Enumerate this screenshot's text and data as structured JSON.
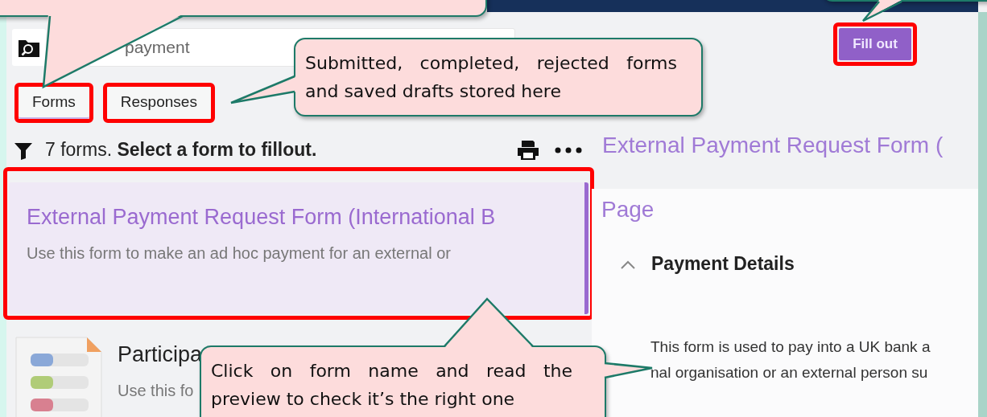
{
  "search": {
    "value": "payment"
  },
  "tabs": [
    {
      "label": "Forms",
      "selected": true
    },
    {
      "label": "Responses",
      "selected": false
    }
  ],
  "list_header": "7 forms. **Select a form to fillout.**",
  "forms": [
    {
      "title": "External Payment Request Form (International B",
      "description": "Use this form to make an ad hoc payment for an external or",
      "selected": true
    },
    {
      "title": "Participa",
      "description": "Use this fo",
      "selected": false
    }
  ],
  "fill_out_button": {
    "label": "Fill out"
  },
  "preview": {
    "title": "External Payment Request Form (",
    "page_label": "Page",
    "section": {
      "title": "Payment Details",
      "expanded": true
    },
    "body": [
      "This form is used to pay into a UK bank a",
      "nal organisation or an external person su"
    ]
  },
  "annotations": [
    {
      "text": "Submitted, completed, rejected forms and saved drafts stored here"
    },
    {
      "text": "Click on form name and read the preview to check it’s the right one"
    }
  ]
}
